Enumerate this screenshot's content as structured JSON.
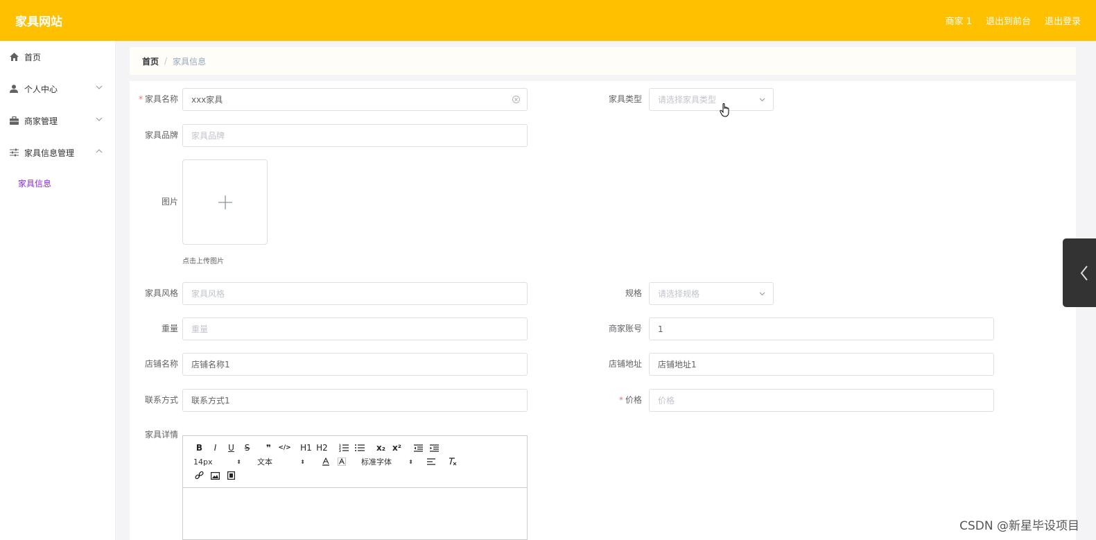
{
  "header": {
    "logo": "家具网站",
    "nav": [
      "商家 1",
      "退出到前台",
      "退出登录"
    ],
    "bg_color": "#ffc000"
  },
  "sidebar": {
    "items": [
      {
        "label": "首页",
        "icon": "home-icon"
      },
      {
        "label": "个人中心",
        "icon": "user-icon",
        "arrow": "down"
      },
      {
        "label": "商家管理",
        "icon": "briefcase-icon",
        "arrow": "down"
      },
      {
        "label": "家具信息管理",
        "icon": "sliders-icon",
        "arrow": "up"
      }
    ],
    "subitems": [
      {
        "label": "家具信息",
        "color": "#8a2be2"
      }
    ]
  },
  "breadcrumb": {
    "home": "首页",
    "separator": "/",
    "current": "家具信息"
  },
  "form": {
    "name": {
      "label": "家具名称",
      "required": true,
      "value": "xxx家具"
    },
    "type": {
      "label": "家具类型",
      "placeholder": "请选择家具类型"
    },
    "brand": {
      "label": "家具品牌",
      "placeholder": "家具品牌"
    },
    "image": {
      "label": "图片",
      "tip": "点击上传图片"
    },
    "style": {
      "label": "家具风格",
      "placeholder": "家具风格"
    },
    "spec": {
      "label": "规格",
      "placeholder": "请选择规格"
    },
    "weight": {
      "label": "重量",
      "placeholder": "重量"
    },
    "merchant_account": {
      "label": "商家账号",
      "value": "1"
    },
    "shop_name": {
      "label": "店铺名称",
      "value": "店铺名称1"
    },
    "shop_address": {
      "label": "店铺地址",
      "value": "店铺地址1"
    },
    "contact": {
      "label": "联系方式",
      "value": "联系方式1"
    },
    "price": {
      "label": "价格",
      "required": true,
      "placeholder": "价格"
    },
    "detail": {
      "label": "家具详情"
    }
  },
  "editor": {
    "row1": [
      "B",
      "I",
      "U",
      "S",
      "❞",
      "</>",
      "H1",
      "H2",
      "ol",
      "ul",
      "x₂",
      "x²",
      "outdent",
      "indent"
    ],
    "font_size": "14px",
    "paragraph": "文本",
    "font_family": "标准字体"
  },
  "watermark": "CSDN @新星毕设项目"
}
